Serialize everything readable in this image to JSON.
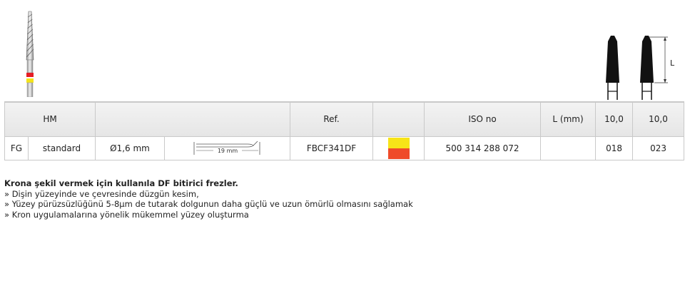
{
  "product": {
    "band_colors": [
      "#e51e25",
      "#f4e41a"
    ]
  },
  "shape_diagram": {
    "dimension_label": "L"
  },
  "table": {
    "headers": {
      "col1": "HM",
      "col2": "",
      "ref": "Ref.",
      "color": "",
      "iso": "ISO no",
      "length": "L (mm)",
      "size1": "10,0",
      "size2": "10,0"
    },
    "row": {
      "type": "FG",
      "grade": "standard",
      "diameter": "Ø1,6 mm",
      "dimension_label": "19 mm",
      "ref": "FBCF341DF",
      "color_top": "#f7e418",
      "color_bottom": "#ef4b2a",
      "iso": "500 314 288 072",
      "length": "",
      "size1": "018",
      "size2": "023"
    }
  },
  "description": {
    "heading": "Krona şekil vermek için kullanıla DF bitirici frezler.",
    "bullets": [
      "» Dişin yüzeyinde ve çevresinde düzgün kesim,",
      "» Yüzey pürüzsüzlüğünü 5-8µm de tutarak dolgunun daha güçlü ve uzun ömürlü olmasını sağlamak",
      "» Kron uygulamalarına yönelik mükemmel yüzey oluşturma"
    ]
  }
}
